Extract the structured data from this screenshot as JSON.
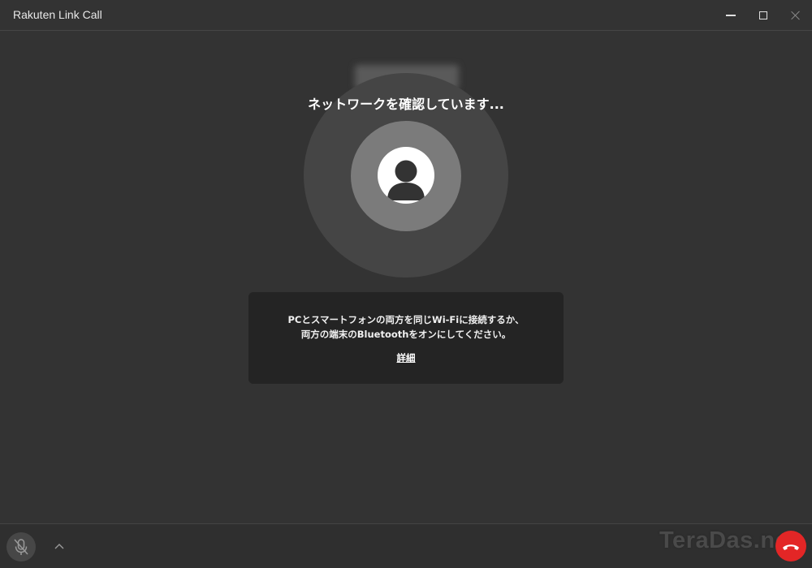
{
  "window": {
    "title": "Rakuten Link Call",
    "controls": [
      "minimize-icon",
      "maximize-icon",
      "close-icon"
    ]
  },
  "call": {
    "status": "ネットワークを確認しています...",
    "avatar_icon": "person-icon"
  },
  "info": {
    "line1": "PCとスマートフォンの両方を同じWi-Fiに接続するか、",
    "line2": "両方の端末のBluetoothをオンにしてください。",
    "link": "詳細"
  },
  "bottom": {
    "mic_icon": "mic-muted-icon",
    "expand_icon": "chevron-up-icon",
    "hangup_icon": "phone-hangup-icon",
    "watermark": "TeraDas.net"
  },
  "colors": {
    "background": "#333333",
    "info_box": "#242424",
    "hangup": "#e32626"
  }
}
